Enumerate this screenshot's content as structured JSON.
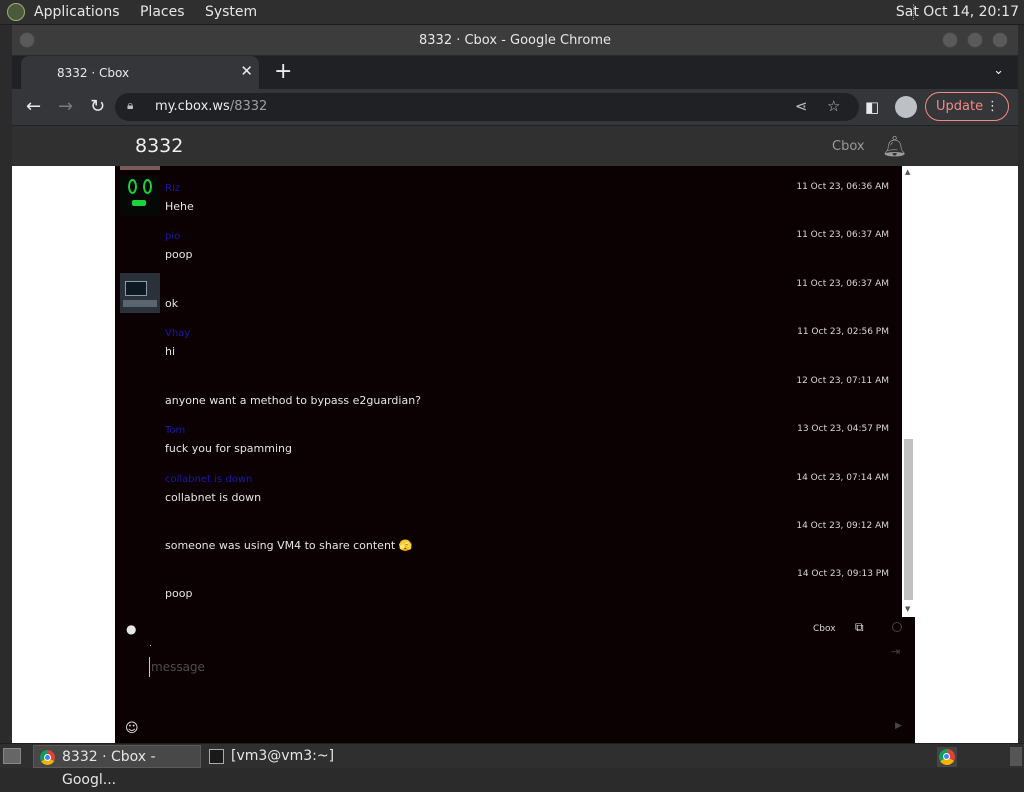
{
  "panel": {
    "menus": [
      "Applications",
      "Places",
      "System"
    ],
    "clock": "Sat Oct 14, 20:17"
  },
  "browser": {
    "window_title": "8332 · Cbox - Google Chrome",
    "tab_title": "8332 · Cbox",
    "url_host": "my.cbox.ws",
    "url_path": "/8332",
    "update_label": "Update"
  },
  "site": {
    "room_name": "8332",
    "brand": "Cbox"
  },
  "messages": [
    {
      "nick": "Riz",
      "time": "11 Oct 23, 06:36 AM",
      "text": "Hehe",
      "avatar": "green-face"
    },
    {
      "nick": "pio",
      "time": "11 Oct 23, 06:37 AM",
      "text": "poop",
      "avatar": "none"
    },
    {
      "nick": "",
      "time": "11 Oct 23, 06:37 AM",
      "text": "ok",
      "avatar": "computer"
    },
    {
      "nick": "Vhay",
      "time": "11 Oct 23, 02:56 PM",
      "text": "hi",
      "avatar": "none"
    },
    {
      "nick": "",
      "time": "12 Oct 23, 07:11 AM",
      "text": "anyone want a method to bypass e2guardian?",
      "avatar": "none"
    },
    {
      "nick": "Tom",
      "time": "13 Oct 23, 04:57 PM",
      "text": "fuck you for spamming",
      "avatar": "none"
    },
    {
      "nick": "collabnet is down",
      "time": "14 Oct 23, 07:14 AM",
      "text": "collabnet is down",
      "avatar": "none"
    },
    {
      "nick": "",
      "time": "14 Oct 23, 09:12 AM",
      "text": "someone was using VM4 to share content 🫣",
      "avatar": "none"
    },
    {
      "nick": "",
      "time": "14 Oct 23, 09:13 PM",
      "text": "poop",
      "avatar": "none"
    }
  ],
  "footer": {
    "cbox_link": "Cbox",
    "name_placeholder": ".",
    "message_placeholder": "message"
  },
  "taskbar": {
    "tasks": [
      "8332 · Cbox - Googl...",
      "[vm3@vm3:~]"
    ]
  }
}
